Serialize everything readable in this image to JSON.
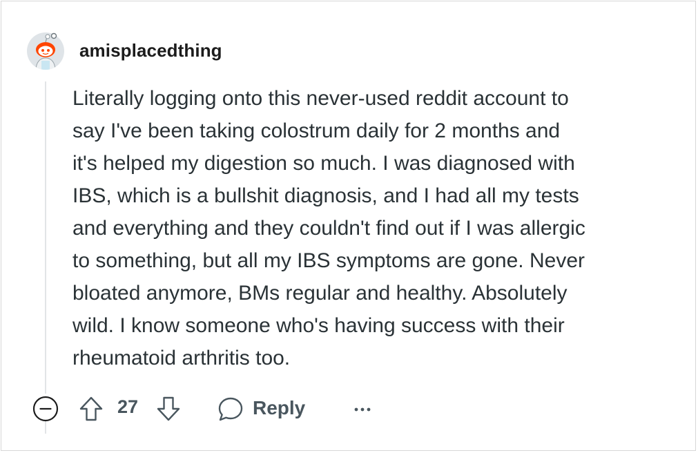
{
  "comment": {
    "author": "amisplacedthing",
    "body": "Literally logging onto this never-used reddit account to say I've been taking colostrum daily for 2 months and it's helped my digestion so much. I was diagnosed with IBS, which is a bullshit diagnosis, and I had all my tests and everything and they couldn't find out if I was allergic to something, but all my IBS symptoms are gone. Never bloated anymore, BMs regular and healthy. Absolutely wild. I know someone who's having success with their rheumatoid arthritis too.",
    "body_lines": [
      "Literally logging onto this never-used reddit account to",
      "say I've been taking colostrum daily for 2 months and",
      "it's helped my digestion so much. I was diagnosed with",
      "IBS, which is a bullshit diagnosis, and I had all my tests",
      "and everything and they couldn't find out if I was allergic",
      "to something, but all my IBS symptoms are gone. Never",
      "bloated anymore, BMs regular and healthy. Absolutely",
      "wild. I know someone who's having success with their",
      "rheumatoid arthritis too."
    ]
  },
  "actions": {
    "score": "27",
    "reply_label": "Reply"
  },
  "icons": {
    "avatar": "snoo-avatar-icon",
    "collapse": "collapse-minus-icon",
    "upvote": "upvote-arrow-icon",
    "downvote": "downvote-arrow-icon",
    "reply": "speech-bubble-icon",
    "more": "more-dots-icon"
  },
  "colors": {
    "text": "#2a3236",
    "username": "#1c1c1c",
    "action": "#49565e",
    "snoo_orange": "#ff4500",
    "thread_line": "#e2e4e6"
  }
}
